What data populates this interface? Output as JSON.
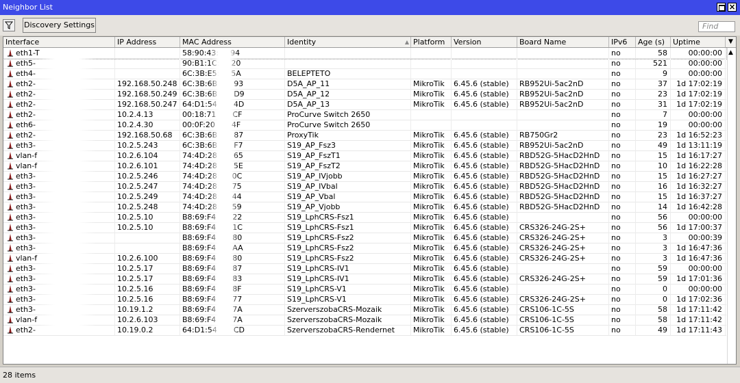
{
  "window": {
    "title": "Neighbor List"
  },
  "toolbar": {
    "discovery_label": "Discovery Settings",
    "find_placeholder": "Find"
  },
  "columns": [
    "Interface",
    "IP Address",
    "MAC Address",
    "Identity",
    "Platform",
    "Version",
    "Board Name",
    "IPv6",
    "Age (s)",
    "Uptime"
  ],
  "rows": [
    [
      "eth1-T",
      "",
      "58:90:43:",
      "94",
      "",
      "",
      "",
      "",
      "no",
      "58",
      "00:00:00"
    ],
    [
      "eth5-",
      "",
      "90:B1:1C:",
      "20",
      "",
      "",
      "",
      "",
      "no",
      "521",
      "00:00:00"
    ],
    [
      "eth4-",
      "",
      "6C:3B:E5:",
      "5A",
      "BELEPTETO",
      "",
      "",
      "",
      "no",
      "9",
      "00:00:00"
    ],
    [
      "eth2-",
      "192.168.50.248",
      "6C:3B:6B",
      "93",
      "D5A_AP_11",
      "MikroTik",
      "6.45.6 (stable)",
      "RB952Ui-5ac2nD",
      "no",
      "37",
      "1d 17:02:19"
    ],
    [
      "eth2-",
      "192.168.50.249",
      "6C:3B:6B",
      "D9",
      "D5A_AP_12",
      "MikroTik",
      "6.45.6 (stable)",
      "RB952Ui-5ac2nD",
      "no",
      "23",
      "1d 17:02:19"
    ],
    [
      "eth2-",
      "192.168.50.247",
      "64:D1:54",
      "4D",
      "D5A_AP_13",
      "MikroTik",
      "6.45.6 (stable)",
      "RB952Ui-5ac2nD",
      "no",
      "31",
      "1d 17:02:19"
    ],
    [
      "eth2-",
      "10.2.4.13",
      "00:18:71",
      "CF",
      "ProCurve Switch 2650",
      "",
      "",
      "",
      "no",
      "7",
      "00:00:00"
    ],
    [
      "eth6-",
      "10.2.4.30",
      "00:0F:20",
      "4F",
      "ProCurve Switch 2650",
      "",
      "",
      "",
      "no",
      "19",
      "00:00:00"
    ],
    [
      "eth2-",
      "192.168.50.68",
      "6C:3B:6B",
      "87",
      "ProxyTik",
      "MikroTik",
      "6.45.6 (stable)",
      "RB750Gr2",
      "no",
      "23",
      "1d 16:52:23"
    ],
    [
      "eth3-",
      "10.2.5.243",
      "6C:3B:6B",
      "F7",
      "S19_AP_Fsz3",
      "MikroTik",
      "6.45.6 (stable)",
      "RB952Ui-5ac2nD",
      "no",
      "49",
      "1d 13:11:19"
    ],
    [
      "vlan-f",
      "10.2.6.104",
      "74:4D:28",
      "65",
      "S19_AP_FszT1",
      "MikroTik",
      "6.45.6 (stable)",
      "RBD52G-5HacD2HnD",
      "no",
      "15",
      "1d 16:17:27"
    ],
    [
      "vlan-f",
      "10.2.6.101",
      "74:4D:28",
      "5E",
      "S19_AP_FszT2",
      "MikroTik",
      "6.45.6 (stable)",
      "RBD52G-5HacD2HnD",
      "no",
      "10",
      "1d 16:22:28"
    ],
    [
      "eth3-",
      "10.2.5.246",
      "74:4D:28:4",
      "0C",
      "S19_AP_IVjobb",
      "MikroTik",
      "6.45.6 (stable)",
      "RBD52G-5HacD2HnD",
      "no",
      "15",
      "1d 16:27:27"
    ],
    [
      "eth3-",
      "10.2.5.247",
      "74:4D:28:4",
      "75",
      "S19_AP_IVbal",
      "MikroTik",
      "6.45.6 (stable)",
      "RBD52G-5HacD2HnD",
      "no",
      "16",
      "1d 16:32:27"
    ],
    [
      "eth3-",
      "10.2.5.249",
      "74:4D:28:4",
      "44",
      "S19_AP_Vbal",
      "MikroTik",
      "6.45.6 (stable)",
      "RBD52G-5HacD2HnD",
      "no",
      "15",
      "1d 16:37:27"
    ],
    [
      "eth3-",
      "10.2.5.248",
      "74:4D:28:4",
      "59",
      "S19_AP_Vjobb",
      "MikroTik",
      "6.45.6 (stable)",
      "RBD52G-5HacD2HnD",
      "no",
      "14",
      "1d 16:42:28"
    ],
    [
      "eth3-",
      "10.2.5.10",
      "B8:69:F4",
      "22",
      "S19_LphCRS-Fsz1",
      "MikroTik",
      "6.45.6 (stable)",
      "",
      "no",
      "56",
      "00:00:00"
    ],
    [
      "eth3-",
      "10.2.5.10",
      "B8:69:F4",
      "1C",
      "S19_LphCRS-Fsz1",
      "MikroTik",
      "6.45.6 (stable)",
      "CRS326-24G-2S+",
      "no",
      "56",
      "1d 17:00:37"
    ],
    [
      "eth3-",
      "",
      "B8:69:F4",
      "80",
      "S19_LphCRS-Fsz2",
      "MikroTik",
      "6.45.6 (stable)",
      "CRS326-24G-2S+",
      "no",
      "3",
      "00:00:39"
    ],
    [
      "eth3-",
      "",
      "B8:69:F4",
      "AA",
      "S19_LphCRS-Fsz2",
      "MikroTik",
      "6.45.6 (stable)",
      "CRS326-24G-2S+",
      "no",
      "3",
      "1d 16:47:36"
    ],
    [
      "vlan-f",
      "10.2.6.100",
      "B8:69:F4",
      "80",
      "S19_LphCRS-Fsz2",
      "MikroTik",
      "6.45.6 (stable)",
      "CRS326-24G-2S+",
      "no",
      "3",
      "1d 16:47:36"
    ],
    [
      "eth3-",
      "10.2.5.17",
      "B8:69:F4",
      "87",
      "S19_LphCRS-IV1",
      "MikroTik",
      "6.45.6 (stable)",
      "",
      "no",
      "59",
      "00:00:00"
    ],
    [
      "eth3-",
      "10.2.5.17",
      "B8:69:F4",
      "83",
      "S19_LphCRS-IV1",
      "MikroTik",
      "6.45.6 (stable)",
      "CRS326-24G-2S+",
      "no",
      "59",
      "1d 17:01:36"
    ],
    [
      "eth3-",
      "10.2.5.16",
      "B8:69:F4",
      "8F",
      "S19_LphCRS-V1",
      "MikroTik",
      "6.45.6 (stable)",
      "",
      "no",
      "0",
      "00:00:00"
    ],
    [
      "eth3-",
      "10.2.5.16",
      "B8:69:F4",
      "77",
      "S19_LphCRS-V1",
      "MikroTik",
      "6.45.6 (stable)",
      "CRS326-24G-2S+",
      "no",
      "0",
      "1d 17:02:36"
    ],
    [
      "eth3-",
      "10.19.1.2",
      "B8:69:F4",
      "7A",
      "SzerverszobaCRS-Mozaik",
      "MikroTik",
      "6.45.6 (stable)",
      "CRS106-1C-5S",
      "no",
      "58",
      "1d 17:11:42"
    ],
    [
      "vlan-f",
      "10.2.6.103",
      "B8:69:F4",
      "7A",
      "SzerverszobaCRS-Mozaik",
      "MikroTik",
      "6.45.6 (stable)",
      "CRS106-1C-5S",
      "no",
      "58",
      "1d 17:11:42"
    ],
    [
      "eth2-",
      "10.19.0.2",
      "64:D1:54",
      "CD",
      "SzerverszobaCRS-Rendernet",
      "MikroTik",
      "6.45.6 (stable)",
      "CRS106-1C-5S",
      "no",
      "49",
      "1d 17:11:43"
    ]
  ],
  "status": {
    "count": "28 items"
  },
  "colors": {
    "titlebar": "#3d4ae8",
    "chrome": "#d4d0c8",
    "icon": "#8b1a1a"
  }
}
